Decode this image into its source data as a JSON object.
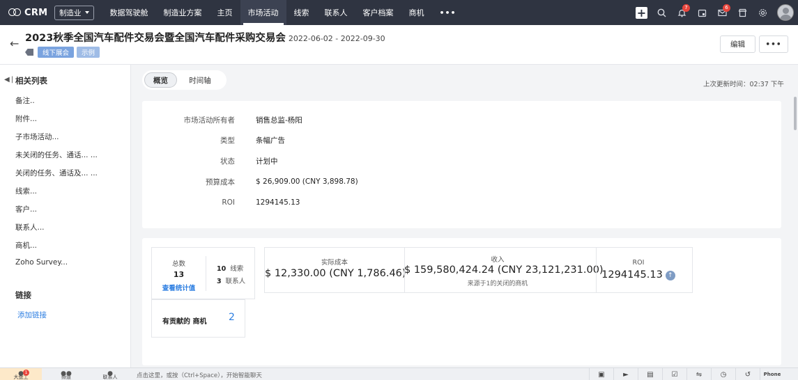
{
  "nav": {
    "app_name": "CRM",
    "industry": "制造业",
    "tabs": [
      "数据驾驶舱",
      "制造业方案",
      "主页",
      "市场活动",
      "线索",
      "联系人",
      "客户档案",
      "商机"
    ],
    "active_tab": "市场活动",
    "more": "•••",
    "plus": "+",
    "icons": [
      "search-icon",
      "bell-icon",
      "calendar-icon",
      "mail-icon",
      "store-icon",
      "gear-icon"
    ],
    "bell_badge": "7",
    "mail_badge": "6"
  },
  "header": {
    "title": "2023秋季全国汽车配件交易会暨全国汽车配件采购交易会",
    "dates": "2022-06-02 - 2022-09-30",
    "tags": [
      "线下展会",
      "示例"
    ],
    "edit_label": "编辑",
    "more_label": "•••"
  },
  "sidebar": {
    "heading": "相关列表",
    "items": [
      "备注..",
      "附件...",
      "子市场活动...",
      "未关闭的任务、通话... ...",
      "关闭的任务、通话及... ...",
      "线索...",
      "客户...",
      "联系人...",
      "商机...",
      "Zoho Survey..."
    ],
    "links_heading": "链接",
    "add_link": "添加链接"
  },
  "view_toggle": {
    "overview": "概览",
    "timeline": "时间轴"
  },
  "last_updated": "上次更新时间：02:37 下午",
  "details": [
    {
      "label": "市场活动所有者",
      "value": "销售总监-杨阳"
    },
    {
      "label": "类型",
      "value": "条幅广告"
    },
    {
      "label": "状态",
      "value": "计划中"
    },
    {
      "label": "预算成本",
      "value": "$ 26,909.00 (CNY 3,898.78)"
    },
    {
      "label": "ROI",
      "value": "1294145.13"
    }
  ],
  "summary": {
    "total_label": "总数",
    "total_value": "13",
    "view_stats": "查看统计值",
    "leads_count": "10",
    "leads_label": "线索",
    "contacts_count": "3",
    "contacts_label": "联系人",
    "actual_cost_label": "实际成本",
    "actual_cost_value": "$ 12,330.00 (CNY 1,786.46)",
    "revenue_label": "收入",
    "revenue_value": "$ 159,580,424.24 (CNY 23,121,231.00)",
    "revenue_note": "来源于1的关闭的商机",
    "roi_label": "ROI",
    "roi_value": "1294145.13",
    "contrib_label": "有贡献的 商机",
    "contrib_value": "2"
  },
  "bottom_bar": {
    "chat_placeholder": "点击这里，或按（Ctrl+Space），开始智能聊天",
    "cell_labels": [
      "大盘工",
      "频道",
      "联系人"
    ],
    "badge": "1",
    "phone_label": "Phone"
  }
}
